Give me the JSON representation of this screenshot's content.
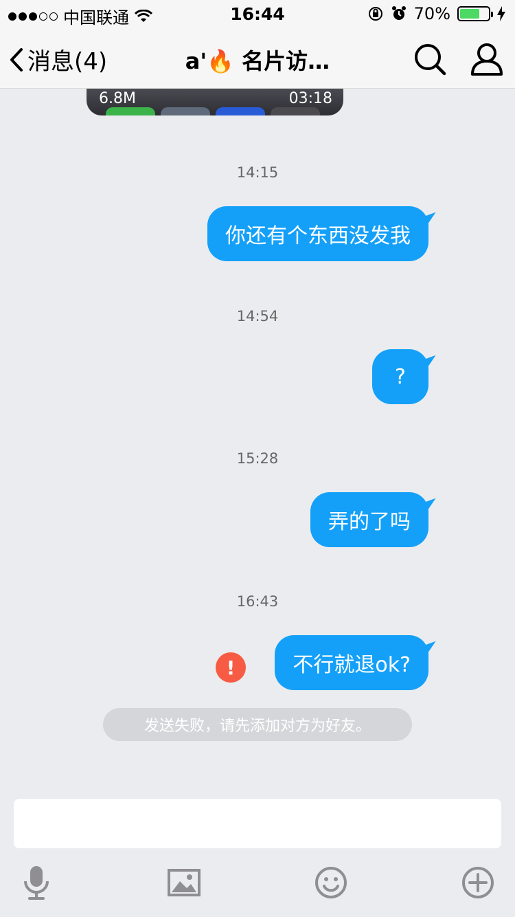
{
  "status_bar": {
    "carrier": "中国联通",
    "time": "16:44",
    "battery": "70%",
    "battery_level": 0.7
  },
  "nav": {
    "back_label": "消息(4)",
    "title": "a'🔥 名片访…"
  },
  "video": {
    "size": "6.8M",
    "duration": "03:18"
  },
  "messages": [
    {
      "time": "14:15",
      "text": "你还有个东西没发我"
    },
    {
      "time": "14:54",
      "text": "?"
    },
    {
      "time": "15:28",
      "text": "弄的了吗"
    },
    {
      "time": "16:43",
      "text": "不行就退ok?"
    }
  ],
  "failure_notice": "发送失败，请先添加对方为好友。",
  "colors": {
    "bubble": "#14a0f8",
    "fail": "#f75b43",
    "battery": "#4cd964"
  },
  "toolbar": {
    "icons": [
      "microphone-icon",
      "image-icon",
      "emoji-icon",
      "plus-circle-icon"
    ]
  }
}
